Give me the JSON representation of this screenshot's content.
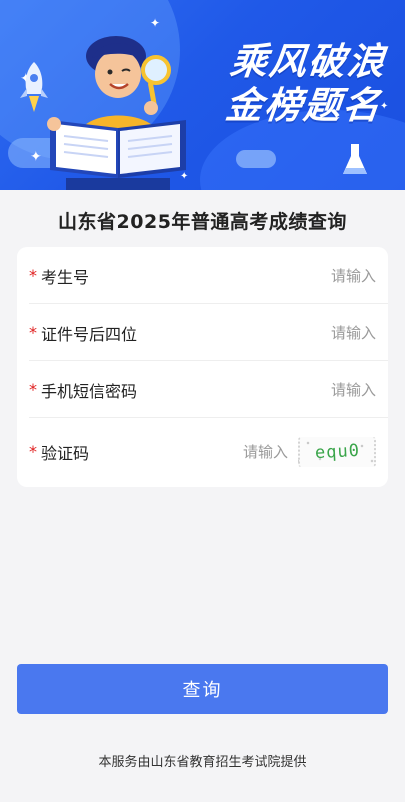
{
  "banner": {
    "slogan_line1": "乘风破浪",
    "slogan_line2": "金榜题名",
    "illustration_icons": [
      "rocket-icon",
      "student-reading-icon",
      "magnifier-icon",
      "flask-icon",
      "sparkle-icon"
    ]
  },
  "page_title": "山东省2025年普通高考成绩查询",
  "form": {
    "required_mark": "*",
    "fields": [
      {
        "label": "考生号",
        "placeholder": "请输入",
        "value": ""
      },
      {
        "label": "证件号后四位",
        "placeholder": "请输入",
        "value": ""
      },
      {
        "label": "手机短信密码",
        "placeholder": "请输入",
        "value": ""
      },
      {
        "label": "验证码",
        "placeholder": "请输入",
        "value": ""
      }
    ],
    "captcha_text": "equ0"
  },
  "actions": {
    "query_label": "查询"
  },
  "footer": {
    "note": "本服务由山东省教育招生考试院提供"
  },
  "colors": {
    "banner_blue": "#2059e8",
    "button_blue": "#4a78ef",
    "required_red": "#e02020",
    "captcha_green": "#3aa54a",
    "page_bg": "#f4f4f6"
  }
}
